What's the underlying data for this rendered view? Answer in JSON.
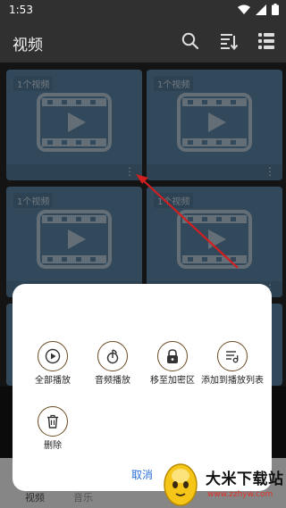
{
  "statusbar": {
    "time": "1:53"
  },
  "appbar": {
    "title": "视频"
  },
  "cards": [
    {
      "badge": "1个视频"
    },
    {
      "badge": "1个视频"
    },
    {
      "badge": "1个视频"
    },
    {
      "badge": "1个视频"
    }
  ],
  "sheet": {
    "actions": [
      {
        "label": "全部播放",
        "icon": "play-circle-icon"
      },
      {
        "label": "音频播放",
        "icon": "audio-note-icon"
      },
      {
        "label": "移至加密区",
        "icon": "lock-icon"
      },
      {
        "label": "添加到播放列表",
        "icon": "add-playlist-icon"
      },
      {
        "label": "删除",
        "icon": "trash-icon"
      }
    ],
    "cancel": "取消"
  },
  "bottomnav": {
    "tab1": "视频",
    "tab2": "音乐"
  },
  "watermark": {
    "title": "大米下载站",
    "url": "www.zzhyw.com"
  },
  "colors": {
    "card": "#5b86a7",
    "accent": "#2b6fd8",
    "arrow": "#d11f1f",
    "iconStroke": "#6b4a22"
  }
}
